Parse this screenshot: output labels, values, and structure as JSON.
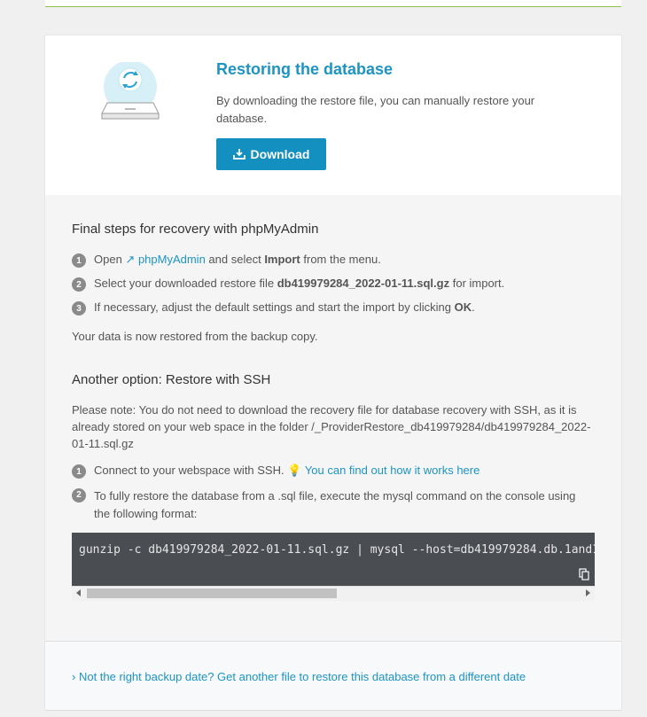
{
  "restore": {
    "title": "Restoring the database",
    "description": "By downloading the restore file, you can manually restore your database.",
    "download_label": "Download"
  },
  "phpmyadmin": {
    "heading": "Final steps for recovery with phpMyAdmin",
    "steps": [
      {
        "num": "1",
        "pre": "Open ",
        "link": "phpMyAdmin",
        "mid": " and select ",
        "bold": "Import",
        "post": " from the menu."
      },
      {
        "num": "2",
        "pre": "Select your downloaded restore file ",
        "bold": "db419979284_2022-01-11.sql.gz",
        "post": " for import."
      },
      {
        "num": "3",
        "pre": "If necessary, adjust the default settings and start the import by clicking ",
        "bold": "OK",
        "post": "."
      }
    ],
    "done_text": "Your data is now restored from the backup copy."
  },
  "ssh": {
    "heading": "Another option: Restore with SSH",
    "note": "Please note: You do not need to download the recovery file for database recovery with SSH, as it is already stored on your web space in the folder /_ProviderRestore_db419979284/db419979284_2022-01-11.sql.gz",
    "steps": [
      {
        "num": "1",
        "pre": "Connect to your webspace with SSH. ",
        "link": "You can find out how it works here"
      },
      {
        "num": "2",
        "pre": "To fully restore the database from a .sql file, execute the mysql command on the console using the following format:"
      }
    ],
    "command": "gunzip -c db419979284_2022-01-11.sql.gz | mysql --host=db419979284.db.1and1."
  },
  "footer": {
    "link": "Not the right backup date? Get another file to restore this database from a different date"
  },
  "colors": {
    "accent": "#1d94c4",
    "button": "#1390bf"
  }
}
